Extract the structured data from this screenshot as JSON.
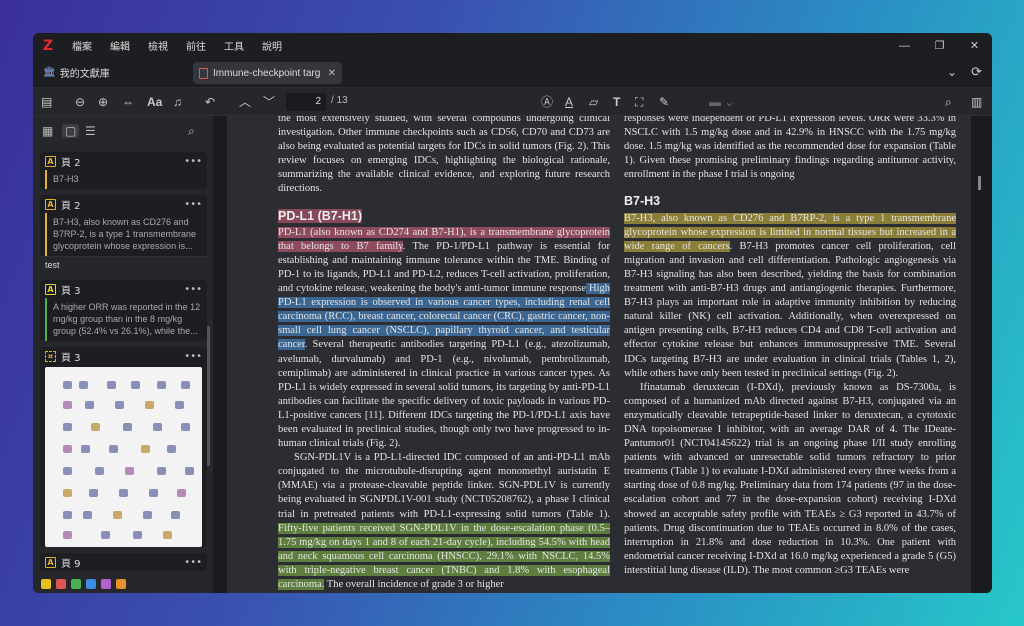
{
  "app": {
    "logo": "Z",
    "menu": [
      "檔案",
      "編輯",
      "檢視",
      "前往",
      "工具",
      "說明"
    ],
    "window_controls": [
      "—",
      "❐",
      "✕"
    ]
  },
  "tabs": {
    "library_label": "我的文獻庫",
    "document_label": "Immune-checkpoint targ",
    "close": "✕"
  },
  "toolbar": {
    "page_current": "2",
    "page_total": "/ 13"
  },
  "sidebar": {
    "cards": [
      {
        "icon": "A",
        "title": "頁 2",
        "text": "B7-H3",
        "color": "#e0b030"
      },
      {
        "icon": "A",
        "title": "頁 2",
        "text": "B7-H3, also known as CD276 and B7RP-2, is a type 1 transmembrane glycoprotein whose expression is...",
        "comment": "test",
        "color": "#e0b030"
      },
      {
        "icon": "A",
        "title": "頁 3",
        "text": "A higher ORR was reported in the 12 mg/kg group than in the 8 mg/kg group (52.4% vs 26.1%), while the...",
        "color": "#4caf50"
      },
      {
        "icon": "⌗",
        "title": "頁 3"
      },
      {
        "icon": "A",
        "title": "頁 9"
      }
    ],
    "colors": [
      "#e8c020",
      "#e05555",
      "#4caf50",
      "#3d8be0",
      "#b060d0",
      "#e8902a"
    ]
  },
  "document": {
    "left": {
      "intro": "the most extensively studied, with several compounds undergoing clinical investigation. Other immune checkpoints such as CD56, CD70 and CD73 are also being evaluated as potential targets for IDCs in solid tumors (Fig. 2). This review focuses on emerging IDCs, highlighting the biological rationale, summarizing the available clinical evidence, and exploring future research directions.",
      "heading": "PD-L1 (B7-H1)",
      "p1_red": "PD-L1 (also known as CD274 and B7-H1), is a transmembrane glycoprotein that belongs to B7 family",
      "p1_mid": ". The PD-1/PD-L1 pathway is essential for establishing and maintaining immune tolerance within the TME. Binding of PD-1 to its ligands, PD-L1 and PD-L2, reduces T-cell activation, proliferation, and cytokine release, weakening the body's anti-tumor immune response",
      "p1_blue": " High PD-L1 expression is observed in various cancer types, including renal cell carcinoma (RCC), breast cancer, colorectal cancer (CRC), gastric cancer, non-small cell lung cancer (NSCLC), papillary thyroid cancer, and testicular cancer",
      "p1_end": ". Several therapeutic antibodies targeting PD-L1 (e.g., atezolizumab, avelumab, durvalumab) and PD-1 (e.g., nivolumab, pembrolizumab, cemiplimab) are administered in clinical practice in various cancer types. As PD-L1 is widely expressed in several solid tumors, its targeting by anti-PD-L1 antibodies can facilitate the specific delivery of toxic payloads in various PD-L1-positive cancers [11]. Different IDCs targeting the PD-1/PD-L1 axis have been evaluated in preclinical studies, though only two have progressed to in-human clinical trials (Fig. 2).",
      "p2_start": "SGN-PDL1V is a PD-L1-directed IDC composed of an anti-PD-L1 mAb conjugated to the microtubule-disrupting agent monomethyl auristatin E (MMAE) via a protease-cleavable peptide linker. SGN-PDL1V is currently being evaluated in SGNPDL1V-001 study (NCT05208762), a phase I clinical trial in pretreated patients with PD-L1-expressing solid tumors (Table 1). ",
      "p2_green": "Fifty-five patients received SGN-PDL1V in the dose-escalation phase (0.5–1.75 mg/kg on days 1 and 8 of each 21-day cycle), including 54.5% with head and neck squamous cell carcinoma (HNSCC), 29.1% with NSCLC, 14.5% with triple-negative breast cancer (TNBC) and 1.8% with esophageal carcinoma.",
      "p2_end": " The overall incidence of grade 3 or higher"
    },
    "right": {
      "intro": "responses were independent of PD-L1 expression levels. ORR were 33.3% in NSCLC with 1.5 mg/kg dose and in 42.9% in HNSCC with the 1.75 mg/kg dose. 1.5 mg/kg was identified as the recommended dose for expansion (Table 1). Given these promising preliminary findings regarding antitumor activity, enrollment in the phase I trial is ongoing",
      "heading": "B7-H3",
      "p1_yellow": "B7-H3, also known as CD276 and B7RP-2, is a type 1 transmembrane glycoprotein whose expression is limited in normal tissues but increased in a wide range of cancers",
      "p1_end": ". B7-H3 promotes cancer cell proliferation, cell migration and invasion and cell differentiation. Pathologic angiogenesis via B7-H3 signaling has also been described, yielding the basis for combination treatment with anti-B7-H3 drugs and antiangiogenic therapies. Furthermore, B7-H3 plays an important role in adaptive immunity inhibition by reducing natural killer (NK) cell activation. Additionally, when overexpressed on antigen presenting cells, B7-H3 reduces CD4 and CD8 T-cell activation and effector cytokine release but enhances immunosuppressive TME. Several IDCs targeting B7-H3 are under evaluation in clinical trials (Tables 1, 2), while others have only been tested in preclinical settings (Fig. 2).",
      "p2": "Ifinatamab deruxtecan (I-DXd), previously known as DS-7300a, is composed of a humanized mAb directed against B7-H3, conjugated via an enzymatically cleavable tetrapeptide-based linker to deruxtecan, a cytotoxic DNA topoisomerase I inhibitor, with an average DAR of 4. The IDeate-Pantumor01 (NCT04145622) trial is an ongoing phase I/II study enrolling patients with advanced or unresectable solid tumors refractory to prior treatments (Table 1) to evaluate I-DXd administered every three weeks from a starting dose of 0.8 mg/kg. Preliminary data from 174 patients (97 in the dose-escalation cohort and 77 in the dose-expansion cohort) receiving I-DXd showed an acceptable safety profile with TEAEs ≥ G3 reported in 43.7% of patients. Drug discontinuation due to TEAEs occurred in 8.0% of the cases, interruption in 21.8% and dose reduction in 10.3%. One patient with endometrial cancer receiving I-DXd at 16.0 mg/kg experienced a grade 5 (G5) interstitial lung disease (ILD). The most common ≥G3 TEAEs were"
    }
  }
}
